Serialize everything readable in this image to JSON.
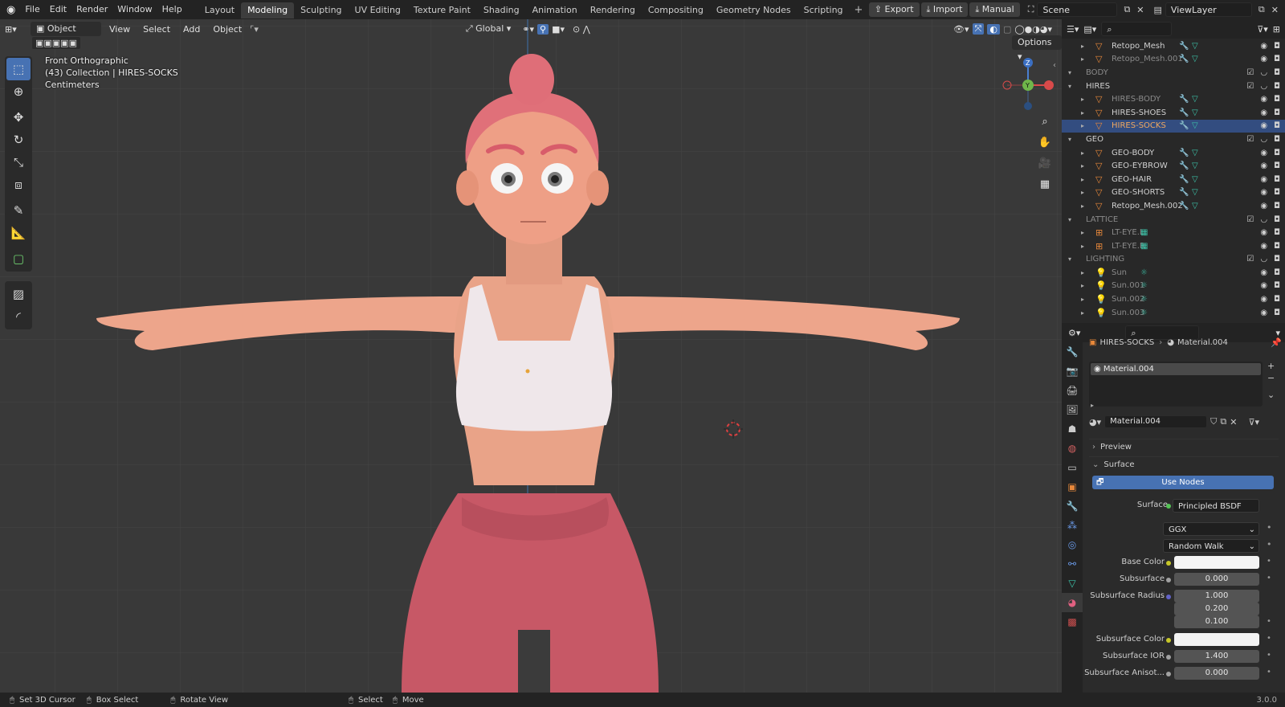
{
  "menu": {
    "items": [
      "File",
      "Edit",
      "Render",
      "Window",
      "Help"
    ]
  },
  "workspaces": [
    "Layout",
    "Modeling",
    "Sculpting",
    "UV Editing",
    "Texture Paint",
    "Shading",
    "Animation",
    "Rendering",
    "Compositing",
    "Geometry Nodes",
    "Scripting"
  ],
  "active_workspace": "Modeling",
  "topright": {
    "export": "Export",
    "import": "Import",
    "manual": "Manual",
    "scene": "Scene",
    "viewlayer": "ViewLayer"
  },
  "viewport": {
    "mode": "Object Mode",
    "menus": [
      "View",
      "Select",
      "Add",
      "Object"
    ],
    "orientation": "Global",
    "options": "Options",
    "info": {
      "view": "Front Orthographic",
      "collection": "(43) Collection | HIRES-SOCKS",
      "units": "Centimeters"
    },
    "axes": {
      "z": "Z",
      "y": "Y"
    }
  },
  "outliner": {
    "rows": [
      {
        "label": "Retopo_Mesh",
        "type": "obj",
        "indent": 1,
        "dim": false
      },
      {
        "label": "Retopo_Mesh.001",
        "type": "obj",
        "indent": 1,
        "dim": true
      },
      {
        "label": "BODY",
        "type": "col",
        "indent": 0,
        "dim": true
      },
      {
        "label": "HIRES",
        "type": "col",
        "indent": 0,
        "dim": false
      },
      {
        "label": "HIRES-BODY",
        "type": "obj",
        "indent": 1,
        "dim": true
      },
      {
        "label": "HIRES-SHOES",
        "type": "obj",
        "indent": 1,
        "dim": false
      },
      {
        "label": "HIRES-SOCKS",
        "type": "obj",
        "indent": 1,
        "dim": false,
        "selected": true
      },
      {
        "label": "GEO",
        "type": "col",
        "indent": 0,
        "dim": false
      },
      {
        "label": "GEO-BODY",
        "type": "obj",
        "indent": 1,
        "dim": false
      },
      {
        "label": "GEO-EYBROW",
        "type": "obj",
        "indent": 1,
        "dim": false
      },
      {
        "label": "GEO-HAIR",
        "type": "obj",
        "indent": 1,
        "dim": false
      },
      {
        "label": "GEO-SHORTS",
        "type": "obj",
        "indent": 1,
        "dim": false
      },
      {
        "label": "Retopo_Mesh.002",
        "type": "obj",
        "indent": 1,
        "dim": false
      },
      {
        "label": "LATTICE",
        "type": "col",
        "indent": 0,
        "dim": true
      },
      {
        "label": "LT-EYE.L",
        "type": "lat",
        "indent": 1,
        "dim": true
      },
      {
        "label": "LT-EYE.R",
        "type": "lat",
        "indent": 1,
        "dim": true
      },
      {
        "label": "LIGHTING",
        "type": "col",
        "indent": 0,
        "dim": true
      },
      {
        "label": "Sun",
        "type": "light",
        "indent": 1,
        "dim": true
      },
      {
        "label": "Sun.001",
        "type": "light",
        "indent": 1,
        "dim": true
      },
      {
        "label": "Sun.002",
        "type": "light",
        "indent": 1,
        "dim": true
      },
      {
        "label": "Sun.003",
        "type": "light",
        "indent": 1,
        "dim": true
      }
    ]
  },
  "properties": {
    "breadcrumb_obj": "HIRES-SOCKS",
    "breadcrumb_mat": "Material.004",
    "slot": "Material.004",
    "material_name": "Material.004",
    "preview": "Preview",
    "surface_panel": "Surface",
    "use_nodes": "Use Nodes",
    "surface_label": "Surface",
    "surface_value": "Principled BSDF",
    "distribution": "GGX",
    "subsurface_method": "Random Walk",
    "fields": [
      {
        "label": "Base Color",
        "kind": "color",
        "value": ""
      },
      {
        "label": "Subsurface",
        "kind": "num",
        "value": "0.000"
      },
      {
        "label": "Subsurface Radius",
        "kind": "vec",
        "values": [
          "1.000",
          "0.200",
          "0.100"
        ]
      },
      {
        "label": "Subsurface Color",
        "kind": "color",
        "value": ""
      },
      {
        "label": "Subsurface IOR",
        "kind": "num",
        "value": "1.400"
      },
      {
        "label": "Subsurface Anisot...",
        "kind": "num",
        "value": "0.000"
      }
    ],
    "colors": {
      "accent": "#4772b3",
      "socket": "#c7c729",
      "vector_socket": "#6363c7"
    }
  },
  "status": {
    "cursor": "Set 3D Cursor",
    "box": "Box Select",
    "rotate": "Rotate View",
    "select": "Select",
    "move": "Move",
    "version": "3.0.0"
  }
}
